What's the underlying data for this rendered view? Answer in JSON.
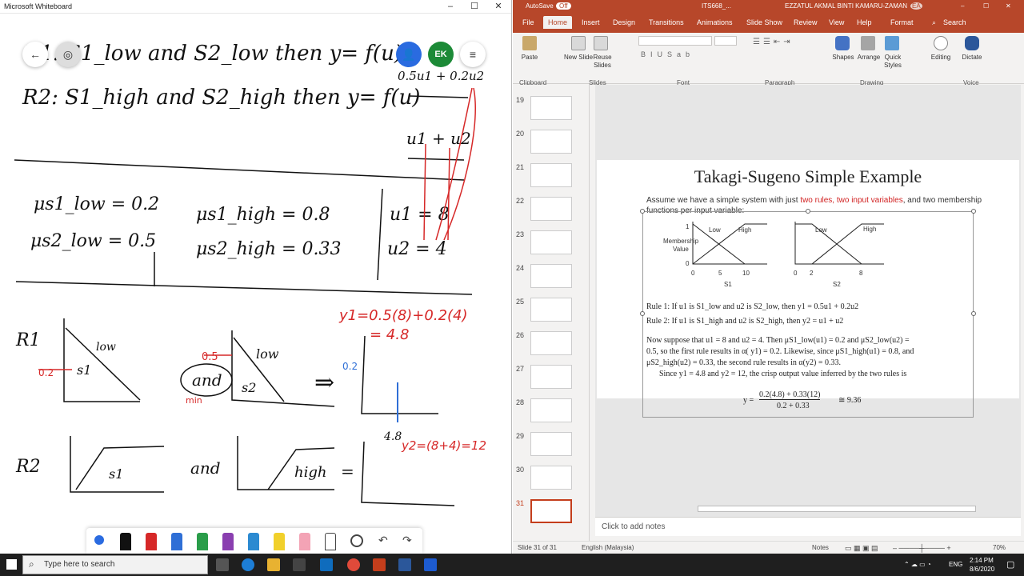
{
  "whiteboard": {
    "app_title": "Microsoft Whiteboard",
    "avatar_initials": "EK",
    "ink": {
      "line1": "R1: S1_low and S2_low then y= f(u)",
      "line2": "R2: S1_high and S2_high then y= f(u)",
      "f1": "0.5u1 + 0.2u2",
      "f2": "u1 + u2",
      "mu_s1_low": "μs1_low = 0.2",
      "mu_s2_low": "μs2_low = 0.5",
      "mu_s1_high": "μs1_high = 0.8",
      "mu_s2_high": "μs2_high = 0.33",
      "u1": "u1 = 8",
      "u2": "u2 = 4",
      "r1": "R1",
      "r2": "R2",
      "low1": "low",
      "low2": "low",
      "s1a": "s1",
      "s2a": "s2",
      "and1": "and",
      "and2": "and",
      "min": "min",
      "v02": "0.2",
      "v05": "0.5",
      "v02b": "0.2",
      "arrow": "⇒",
      "y1eq": "y1=0.5(8)+0.2(4)",
      "y1res": "= 4.8",
      "v48": "4.8",
      "y2eq": "y2=(8+4)=12",
      "s1b": "s1",
      "high": "high",
      "eq": "="
    }
  },
  "ppt": {
    "autosave_label": "AutoSave",
    "autosave_state": "Off",
    "file_name": "ITS668_...",
    "user_name": "EZZATUL AKMAL BINTI KAMARU-ZAMAN",
    "user_initials": "EA",
    "tabs": [
      "File",
      "Home",
      "Insert",
      "Design",
      "Transitions",
      "Animations",
      "Slide Show",
      "Review",
      "View",
      "Help",
      "Format"
    ],
    "search_label": "Search",
    "ribbon": {
      "paste": "Paste",
      "new_slide": "New Slide",
      "reuse_slides": "Reuse Slides",
      "shapes": "Shapes",
      "arrange": "Arrange",
      "quick_styles": "Quick Styles",
      "editing": "Editing",
      "dictate": "Dictate",
      "groups": [
        "Clipboard",
        "Slides",
        "Font",
        "Paragraph",
        "Drawing",
        "Voice"
      ]
    },
    "thumbnails": [
      "19",
      "20",
      "21",
      "22",
      "23",
      "24",
      "25",
      "26",
      "27",
      "28",
      "29",
      "30",
      "31"
    ],
    "slide": {
      "title": "Takagi-Sugeno Simple Example",
      "sub_pre": "Assume we have a simple system with just ",
      "sub_hl": "two rules, two input variables",
      "sub_post": ", and two membership functions per input variable:",
      "mf": {
        "ylabel": "Membership Value",
        "y0": "0",
        "y1": "1",
        "s1_low": "Low",
        "s1_high": "High",
        "s1_ticks": [
          "0",
          "5",
          "10"
        ],
        "s1_label": "S1",
        "s2_low": "Low",
        "s2_high": "High",
        "s2_ticks": [
          "0",
          "2",
          "8"
        ],
        "s2_label": "S2"
      },
      "rule1": "Rule 1: If u1 is S1_low and u2 is S2_low, then y1 = 0.5u1 + 0.2u2",
      "rule2": "Rule 2: If u1 is S1_high and u2 is S2_high, then y2 = u1 + u2",
      "p1": "Now suppose that u1 = 8 and u2 = 4. Then μS1_low(u1) = 0.2 and μS2_low(u2) =",
      "p2": "0.5, so the first rule results in α( y1) = 0.2. Likewise, since μS1_high(u1) = 0.8, and",
      "p3": "μS2_high(u2) = 0.33, the second rule results in α(y2) = 0.33.",
      "p4": "Since y1 = 4.8 and y2 = 12, the crisp output value inferred by the two rules is",
      "eq_lhs": "y =",
      "eq_num": "0.2(4.8) + 0.33(12)",
      "eq_den": "0.2 + 0.33",
      "eq_rhs": "≅ 9.36"
    },
    "notes_placeholder": "Click to add notes",
    "status": {
      "slide_info": "Slide 31 of 31",
      "language": "English (Malaysia)",
      "notes": "Notes",
      "zoom": "70%"
    }
  },
  "taskbar": {
    "search_placeholder": "Type here to search",
    "lang": "ENG",
    "time": "2:14 PM",
    "date": "8/6/2020"
  }
}
